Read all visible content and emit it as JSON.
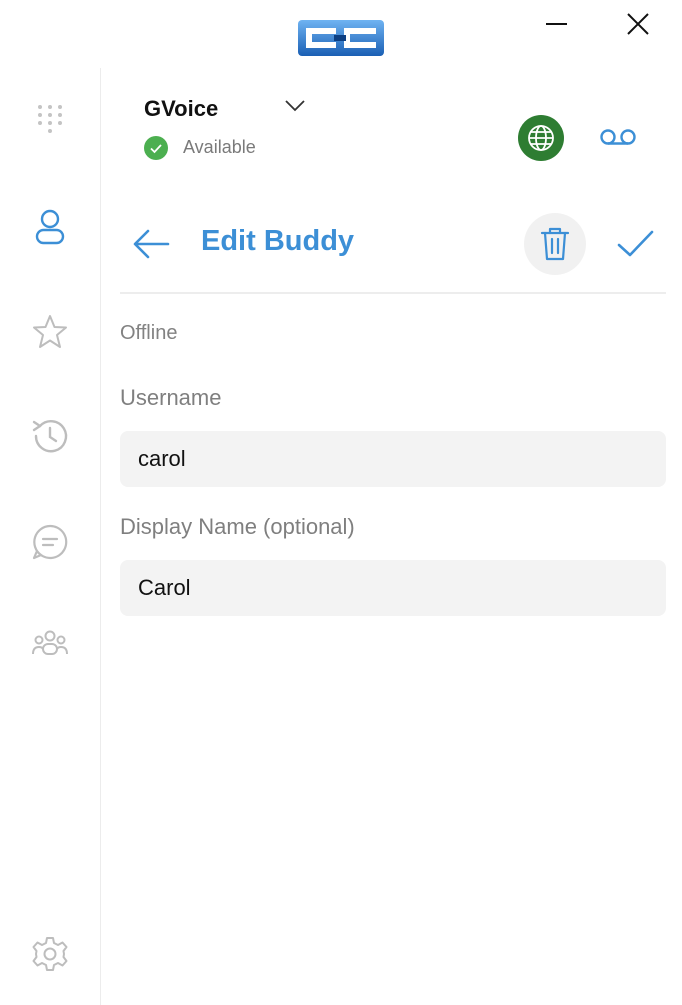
{
  "window": {
    "logo_alt": "CC",
    "minimize_icon": "minimize-icon",
    "close_icon": "close-icon"
  },
  "sidebar": {
    "items": [
      {
        "name": "dialpad",
        "icon": "dialpad-icon"
      },
      {
        "name": "contacts",
        "icon": "contact-icon",
        "active": true
      },
      {
        "name": "favorites",
        "icon": "star-icon"
      },
      {
        "name": "history",
        "icon": "history-icon"
      },
      {
        "name": "chat",
        "icon": "chat-icon"
      },
      {
        "name": "groups",
        "icon": "group-icon"
      }
    ],
    "settings_icon": "gear-icon"
  },
  "account": {
    "name": "GVoice",
    "status": "Available",
    "status_color": "#4caf50"
  },
  "header": {
    "title": "Edit Buddy",
    "accent_color": "#3c8fd6"
  },
  "form": {
    "presence": "Offline",
    "username_label": "Username",
    "username_value": "carol",
    "display_name_label": "Display Name (optional)",
    "display_name_value": "Carol"
  }
}
